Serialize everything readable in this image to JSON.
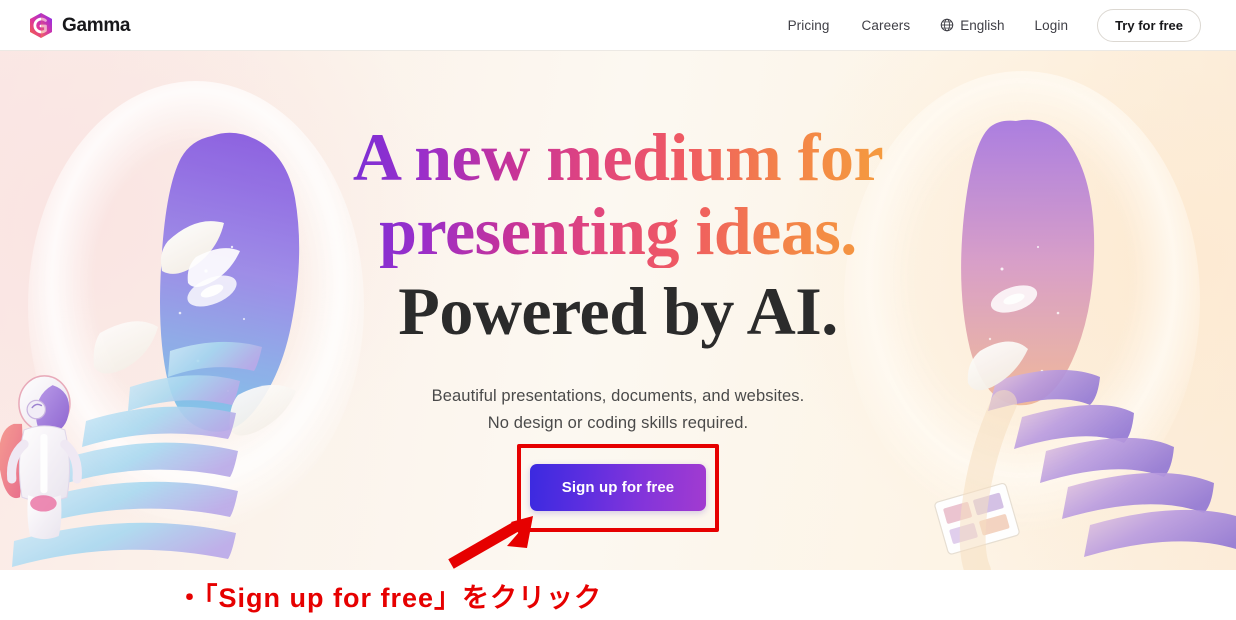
{
  "navbar": {
    "logo_icon": "gamma-hexagon-logo-icon",
    "brand": "Gamma",
    "links": [
      {
        "label": "Pricing",
        "name": "nav-link-pricing"
      },
      {
        "label": "Careers",
        "name": "nav-link-careers"
      }
    ],
    "language": {
      "icon": "globe-icon",
      "label": "English"
    },
    "login_label": "Login",
    "cta_label": "Try for free"
  },
  "hero": {
    "headline_line1": "A new medium for",
    "headline_line2": "presenting ideas.",
    "headline_line3": "Powered by AI.",
    "subtitle_line1": "Beautiful presentations, documents, and websites.",
    "subtitle_line2": "No design or coding skills required.",
    "cta_label": "Sign up for free",
    "left_art": "astronaut-climbing-stairs-to-galaxy-portal",
    "right_art": "galaxy-portal-with-stairs"
  },
  "annotation": {
    "highlight_color": "#e60000",
    "arrow": "red-arrow-pointing-to-signup-button",
    "caption": "・「Sign up for free」をクリック"
  },
  "colors": {
    "background": "#ffffff",
    "hero_background": "#fcf6ee",
    "headline_gradient_start": "#7b2fd6",
    "headline_gradient_end": "#f59b3e",
    "cta_gradient_start": "#3b2ae0",
    "cta_gradient_end": "#a23bd0",
    "annotation_red": "#e60000"
  }
}
